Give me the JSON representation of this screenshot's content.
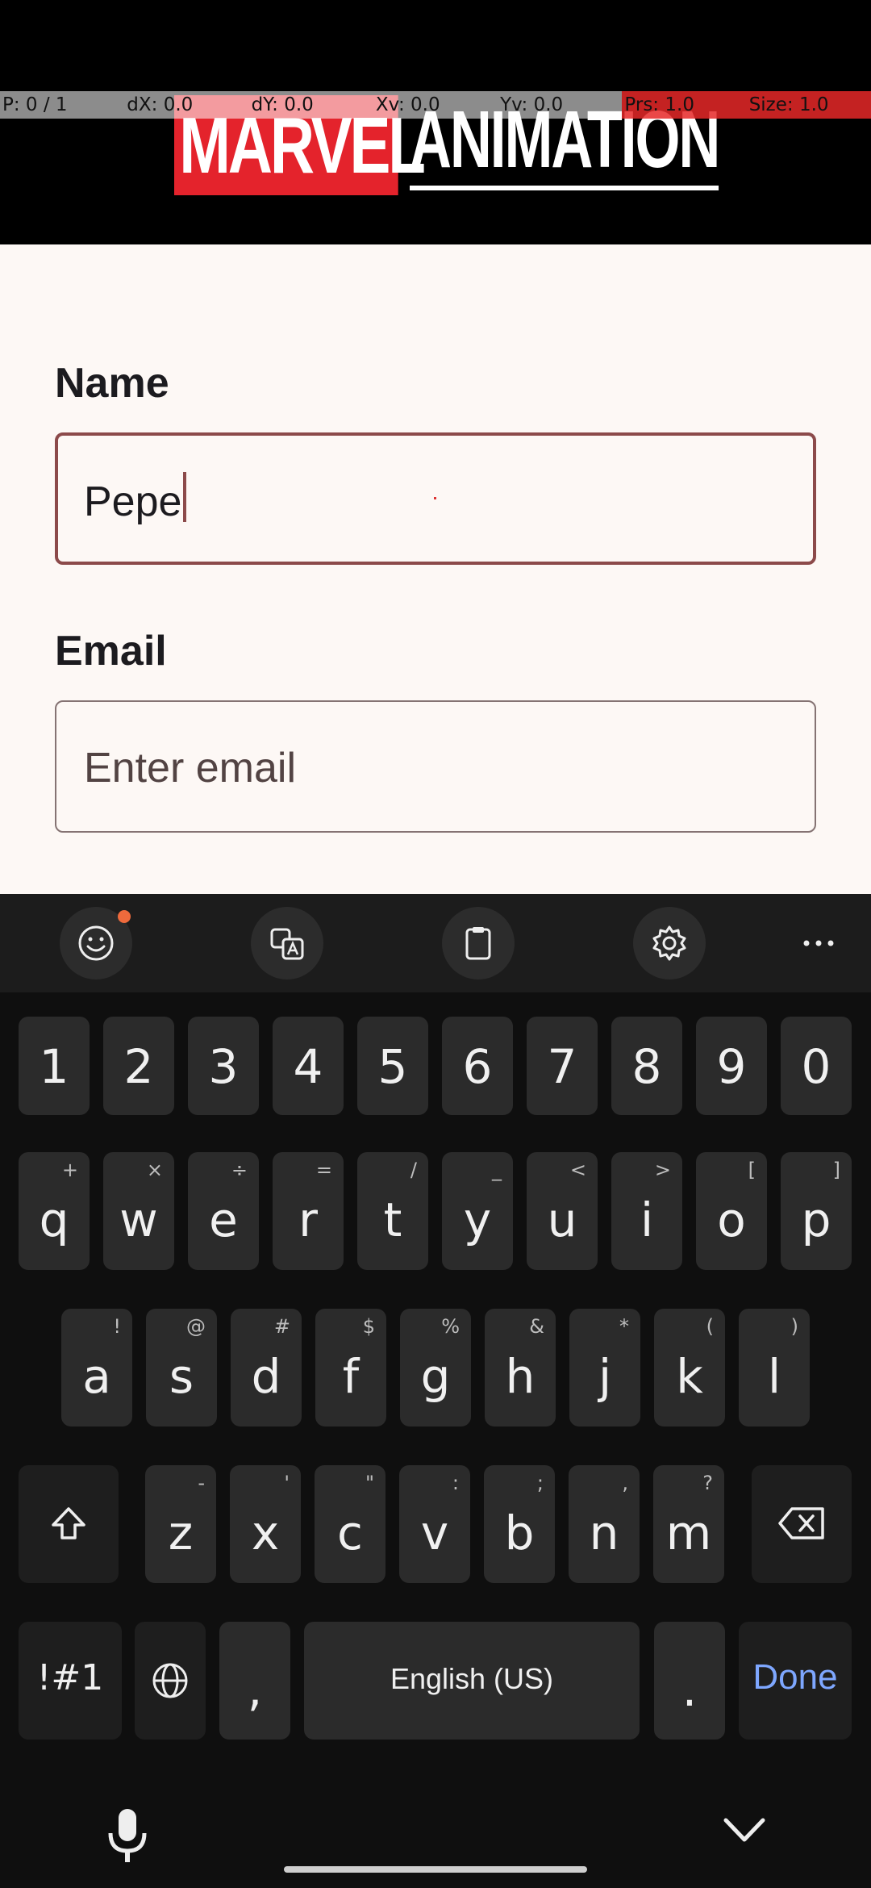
{
  "debug": {
    "pointer": "P: 0 / 1",
    "dx": "dX: 0.0",
    "dy": "dY: 0.0",
    "xv": "Xv: 0.0",
    "yv": "Yv: 0.0",
    "prs": "Prs: 1.0",
    "size": "Size: 1.0"
  },
  "header": {
    "logo_part1": "MARVEL",
    "logo_part2": "ANIMATION"
  },
  "form": {
    "name_label": "Name",
    "name_value": "Pepe",
    "email_label": "Email",
    "email_placeholder": "Enter email"
  },
  "keyboard": {
    "toolbar": {
      "icons": [
        "emoji-icon",
        "translate-icon",
        "clipboard-icon",
        "settings-icon",
        "more-icon"
      ],
      "notification_color": "#ee6a3c"
    },
    "number_row": [
      "1",
      "2",
      "3",
      "4",
      "5",
      "6",
      "7",
      "8",
      "9",
      "0"
    ],
    "row1": [
      {
        "k": "q",
        "h": "+"
      },
      {
        "k": "w",
        "h": "×"
      },
      {
        "k": "e",
        "h": "÷"
      },
      {
        "k": "r",
        "h": "="
      },
      {
        "k": "t",
        "h": "/"
      },
      {
        "k": "y",
        "h": "_"
      },
      {
        "k": "u",
        "h": "<"
      },
      {
        "k": "i",
        "h": ">"
      },
      {
        "k": "o",
        "h": "["
      },
      {
        "k": "p",
        "h": "]"
      }
    ],
    "row2": [
      {
        "k": "a",
        "h": "!"
      },
      {
        "k": "s",
        "h": "@"
      },
      {
        "k": "d",
        "h": "#"
      },
      {
        "k": "f",
        "h": "$"
      },
      {
        "k": "g",
        "h": "%"
      },
      {
        "k": "h",
        "h": "&"
      },
      {
        "k": "j",
        "h": "*"
      },
      {
        "k": "k",
        "h": "("
      },
      {
        "k": "l",
        "h": ")"
      }
    ],
    "row3": [
      {
        "k": "z",
        "h": "-"
      },
      {
        "k": "x",
        "h": "'"
      },
      {
        "k": "c",
        "h": "\""
      },
      {
        "k": "v",
        "h": ":"
      },
      {
        "k": "b",
        "h": ";"
      },
      {
        "k": "n",
        "h": ","
      },
      {
        "k": "m",
        "h": "?"
      }
    ],
    "symbols_label": "!#1",
    "comma_label": ",",
    "space_label": "English (US)",
    "period_label": ".",
    "done_label": "Done",
    "accent_color": "#7ea7ff"
  }
}
